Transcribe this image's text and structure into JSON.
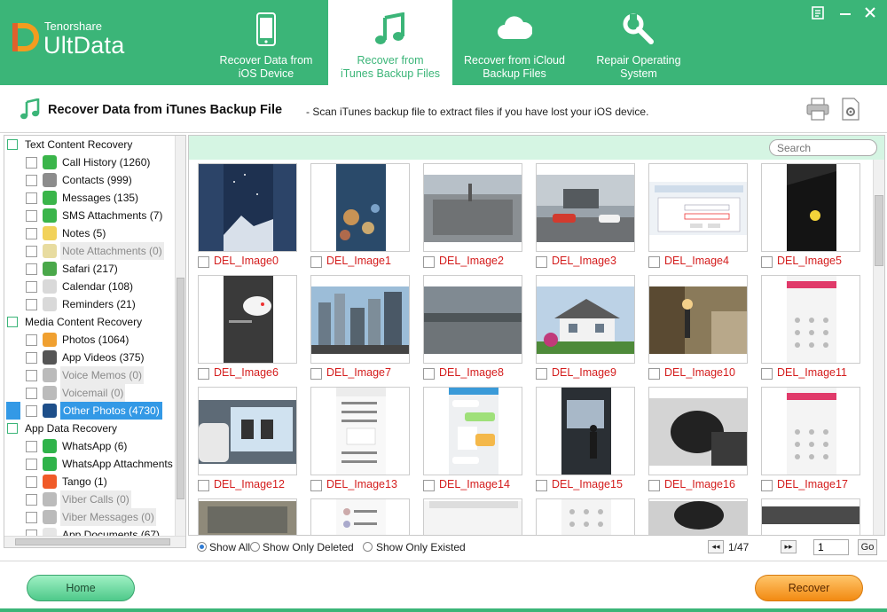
{
  "brand": {
    "company": "Tenorshare",
    "product": "UltData"
  },
  "tabs": [
    {
      "line1": "Recover Data from",
      "line2": "iOS Device",
      "icon": "phone-icon",
      "active": false
    },
    {
      "line1": "Recover from",
      "line2": "iTunes Backup Files",
      "icon": "music-note-icon",
      "active": true
    },
    {
      "line1": "Recover from iCloud",
      "line2": "Backup Files",
      "icon": "cloud-icon",
      "active": false
    },
    {
      "line1": "Repair Operating",
      "line2": "System",
      "icon": "wrench-icon",
      "active": false
    }
  ],
  "title": {
    "main": "Recover Data from iTunes Backup File",
    "sub": "- Scan iTunes backup file to extract files if you have lost your iOS device."
  },
  "tree": {
    "categories": [
      {
        "name": "Text Content Recovery",
        "items": [
          {
            "label": "Call History (1260)",
            "icon": "phone-call-icon",
            "color": "#3ab54a",
            "state": "normal"
          },
          {
            "label": "Contacts (999)",
            "icon": "contacts-icon",
            "color": "#8c8c8c",
            "state": "normal"
          },
          {
            "label": "Messages (135)",
            "icon": "messages-icon",
            "color": "#3ab54a",
            "state": "normal"
          },
          {
            "label": "SMS Attachments (7)",
            "icon": "paperclip-icon",
            "color": "#3ab54a",
            "state": "normal"
          },
          {
            "label": "Notes (5)",
            "icon": "notes-icon",
            "color": "#f2d25a",
            "state": "normal"
          },
          {
            "label": "Note Attachments (0)",
            "icon": "note-attachment-icon",
            "color": "#e8dca0",
            "state": "disabled"
          },
          {
            "label": "Safari (217)",
            "icon": "safari-icon",
            "color": "#4aa84a",
            "state": "normal"
          },
          {
            "label": "Calendar (108)",
            "icon": "calendar-icon",
            "color": "#d9d9d9",
            "state": "normal"
          },
          {
            "label": "Reminders (21)",
            "icon": "reminders-icon",
            "color": "#d9d9d9",
            "state": "normal"
          }
        ]
      },
      {
        "name": "Media Content Recovery",
        "items": [
          {
            "label": "Photos (1064)",
            "icon": "photos-icon",
            "color": "#f0a030",
            "state": "normal"
          },
          {
            "label": "App Videos (375)",
            "icon": "video-icon",
            "color": "#555555",
            "state": "normal"
          },
          {
            "label": "Voice Memos (0)",
            "icon": "voice-memo-icon",
            "color": "#bbbbbb",
            "state": "disabled"
          },
          {
            "label": "Voicemail (0)",
            "icon": "voicemail-icon",
            "color": "#bbbbbb",
            "state": "disabled"
          },
          {
            "label": "Other Photos (4730)",
            "icon": "other-photos-icon",
            "color": "#1e4f8a",
            "state": "selected"
          }
        ]
      },
      {
        "name": "App Data Recovery",
        "items": [
          {
            "label": "WhatsApp (6)",
            "icon": "whatsapp-icon",
            "color": "#2fb34a",
            "state": "normal"
          },
          {
            "label": "WhatsApp Attachments (",
            "icon": "whatsapp-attachment-icon",
            "color": "#2fb34a",
            "state": "normal"
          },
          {
            "label": "Tango (1)",
            "icon": "tango-icon",
            "color": "#f05a28",
            "state": "normal"
          },
          {
            "label": "Viber Calls (0)",
            "icon": "viber-calls-icon",
            "color": "#bbbbbb",
            "state": "disabled"
          },
          {
            "label": "Viber Messages (0)",
            "icon": "viber-messages-icon",
            "color": "#bbbbbb",
            "state": "disabled"
          },
          {
            "label": "App Documents (67)",
            "icon": "app-documents-icon",
            "color": "#e6e6e6",
            "state": "normal"
          }
        ]
      }
    ]
  },
  "search": {
    "placeholder": "Search"
  },
  "grid": {
    "items": [
      {
        "name": "DEL_Image0",
        "thumb": "night-sky-mountain"
      },
      {
        "name": "DEL_Image1",
        "thumb": "bokeh-lights"
      },
      {
        "name": "DEL_Image2",
        "thumb": "city-aerial"
      },
      {
        "name": "DEL_Image3",
        "thumb": "street-red-car"
      },
      {
        "name": "DEL_Image4",
        "thumb": "login-dialog"
      },
      {
        "name": "DEL_Image5",
        "thumb": "dark-poster"
      },
      {
        "name": "DEL_Image6",
        "thumb": "phone-chat-dark"
      },
      {
        "name": "DEL_Image7",
        "thumb": "skyscrapers"
      },
      {
        "name": "DEL_Image8",
        "thumb": "river-city"
      },
      {
        "name": "DEL_Image9",
        "thumb": "house"
      },
      {
        "name": "DEL_Image10",
        "thumb": "street-lamp"
      },
      {
        "name": "DEL_Image11",
        "thumb": "phone-dialer"
      },
      {
        "name": "DEL_Image12",
        "thumb": "phone-screen-photo"
      },
      {
        "name": "DEL_Image13",
        "thumb": "phone-contacts"
      },
      {
        "name": "DEL_Image14",
        "thumb": "chat-messages"
      },
      {
        "name": "DEL_Image15",
        "thumb": "presentation-room"
      },
      {
        "name": "DEL_Image16",
        "thumb": "black-mouse"
      },
      {
        "name": "DEL_Image17",
        "thumb": "phone-dialer"
      },
      {
        "name": "",
        "thumb": "aerial-partial"
      },
      {
        "name": "",
        "thumb": "contacts-partial"
      },
      {
        "name": "",
        "thumb": "blank-partial"
      },
      {
        "name": "",
        "thumb": "dialer-partial"
      },
      {
        "name": "",
        "thumb": "mouse-partial"
      },
      {
        "name": "",
        "thumb": "dark-partial"
      }
    ]
  },
  "filter": {
    "show_all": "Show All",
    "show_deleted": "Show Only Deleted",
    "show_existed": "Show Only Existed",
    "selected": "show_all"
  },
  "pagination": {
    "prev": "◂◂",
    "next": "▸▸",
    "status": "1/47",
    "page_value": "1",
    "go": "Go"
  },
  "footer": {
    "home": "Home",
    "recover": "Recover"
  },
  "colors": {
    "brand_green": "#3bb578",
    "content_bar": "#d5f5e3",
    "deleted_red": "#d41d1d",
    "selection_blue": "#3399e6",
    "recover_orange": "#f28a12"
  }
}
